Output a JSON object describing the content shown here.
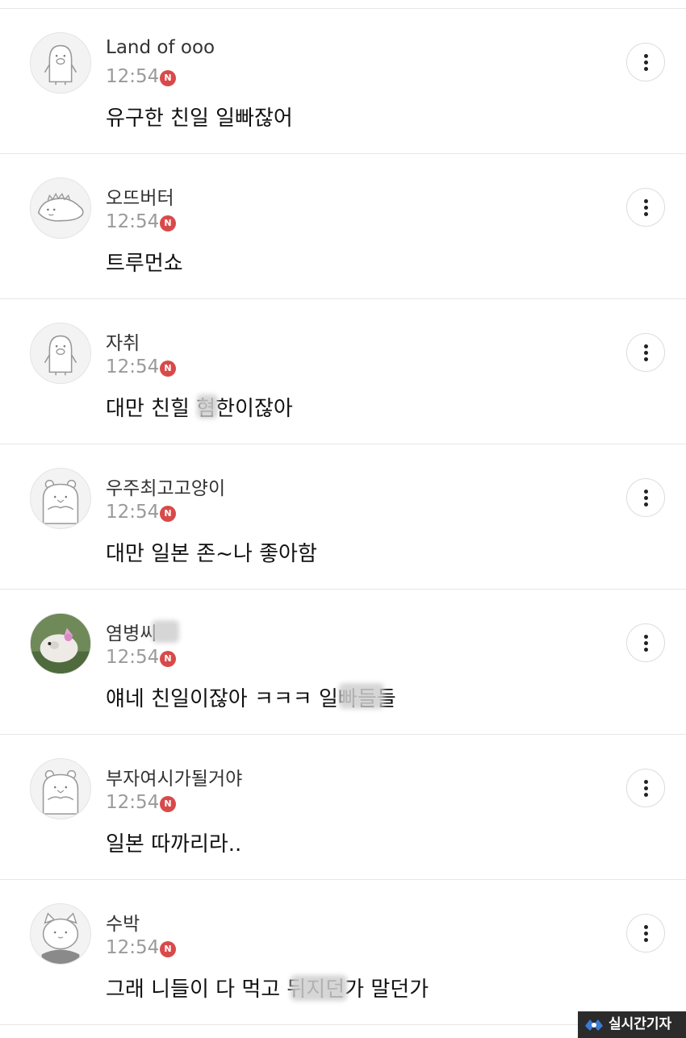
{
  "comments": [
    {
      "author": "Land of ooo",
      "time": "12:54",
      "badge": "N",
      "text": "유구한 친일 일빠잖어",
      "avatar_icon": "penguin-avatar-icon"
    },
    {
      "author": "오뜨버터",
      "time": "12:54",
      "badge": "N",
      "text": "트루먼쇼",
      "avatar_icon": "dinosaur-avatar-icon"
    },
    {
      "author": "자취",
      "time": "12:54",
      "badge": "N",
      "text": "대만 친힐 혐한이잖아",
      "avatar_icon": "penguin-avatar-icon"
    },
    {
      "author": "우주최고고양이",
      "time": "12:54",
      "badge": "N",
      "text": "대만 일본 존~나 좋아함",
      "avatar_icon": "bear-avatar-icon"
    },
    {
      "author": "염병씨",
      "time": "12:54",
      "badge": "N",
      "text": "얘네 친일이잖아 ㅋㅋㅋ 일빠들들",
      "avatar_icon": "hamster-photo-avatar"
    },
    {
      "author": "부자여시가될거야",
      "time": "12:54",
      "badge": "N",
      "text": "일본 따까리라..",
      "avatar_icon": "bear-avatar-icon"
    },
    {
      "author": "수박",
      "time": "12:54",
      "badge": "N",
      "text": "그래 니들이 다 먹고 뒤지던가 말던가",
      "avatar_icon": "cat-avatar-icon"
    }
  ],
  "watermark": {
    "text": "실시간기자",
    "icon": "logo-icon"
  },
  "colors": {
    "badge": "#d84a4a",
    "time": "#9a9a9a",
    "divider": "#e6e6e6"
  }
}
